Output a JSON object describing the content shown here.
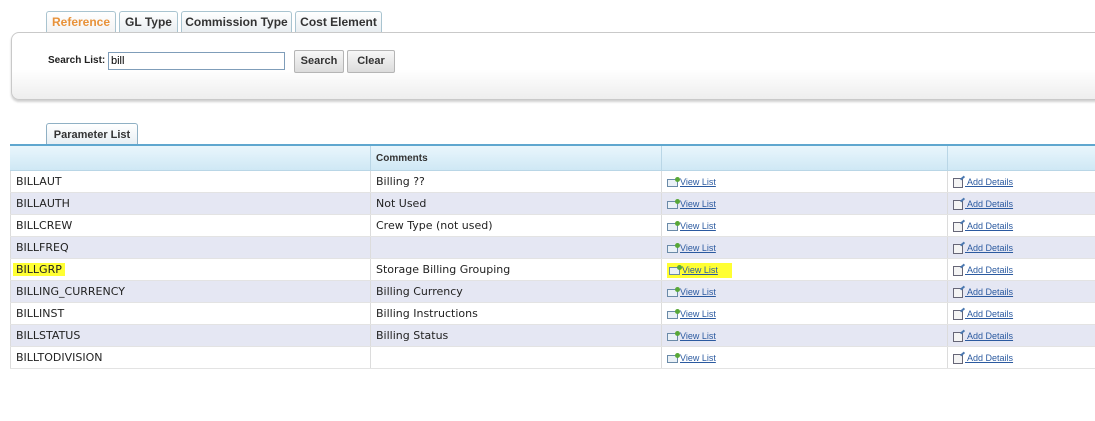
{
  "tabs": [
    {
      "label": "Reference",
      "active": true
    },
    {
      "label": "GL Type",
      "active": false
    },
    {
      "label": "Commission Type",
      "active": false
    },
    {
      "label": "Cost Element",
      "active": false
    }
  ],
  "search": {
    "label": "Search List:",
    "value": "bill",
    "search_button": "Search",
    "clear_button": "Clear"
  },
  "list_tab": "Parameter List",
  "table": {
    "headers": [
      "",
      "Comments",
      "",
      ""
    ],
    "view_label": "View List",
    "add_label": "Add Details",
    "rows": [
      {
        "name": "BILLAUT",
        "comment": "Billing ??"
      },
      {
        "name": "BILLAUTH",
        "comment": "Not Used"
      },
      {
        "name": "BILLCREW",
        "comment": "Crew Type (not used)"
      },
      {
        "name": "BILLFREQ",
        "comment": ""
      },
      {
        "name": "BILLGRP",
        "comment": "Storage Billing Grouping",
        "highlighted": true
      },
      {
        "name": "BILLING_CURRENCY",
        "comment": "Billing Currency"
      },
      {
        "name": "BILLINST",
        "comment": "Billing Instructions"
      },
      {
        "name": "BILLSTATUS",
        "comment": "Billing Status"
      },
      {
        "name": "BILLTODIVISION",
        "comment": ""
      }
    ]
  },
  "colors": {
    "active_tab_text": "#e8923a",
    "link": "#2b5aa0",
    "highlight": "#ffff33",
    "header_border": "#5fa7cf",
    "alt_row": "#e5e7f3"
  }
}
